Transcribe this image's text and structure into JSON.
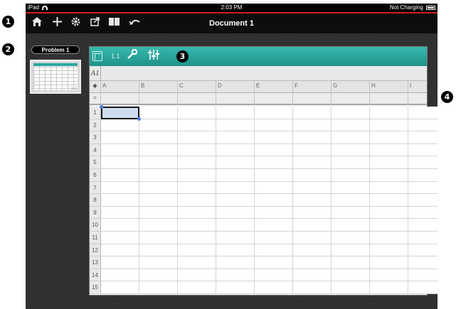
{
  "status_bar": {
    "device": "iPad",
    "time": "2:03 PM",
    "battery_text": "Not Charging"
  },
  "toolbar": {
    "document_title": "Document 1",
    "buttons": [
      "home-icon",
      "plus-icon",
      "gear-icon",
      "share-icon",
      "book-icon",
      "undo-icon"
    ]
  },
  "sidebar": {
    "problem_label": "Problem 1",
    "thumbnail_page": "1.1"
  },
  "page": {
    "tab_label": "1.1",
    "formula_prefix": "A1"
  },
  "spreadsheet": {
    "columns": [
      "A",
      "B",
      "C",
      "D",
      "E",
      "F",
      "G",
      "H",
      "I"
    ],
    "rows": [
      "1",
      "2",
      "3",
      "4",
      "5",
      "6",
      "7",
      "8",
      "9",
      "10",
      "11",
      "12",
      "13",
      "14",
      "15"
    ],
    "formula_row_symbol": "=",
    "corner_symbol": "◆",
    "selected_cell": "A1"
  },
  "callouts": [
    "1",
    "2",
    "3",
    "4"
  ],
  "colors": {
    "accent_teal": "#1e9389",
    "status_red": "#d01f1f",
    "selection": "#cfdcef"
  }
}
